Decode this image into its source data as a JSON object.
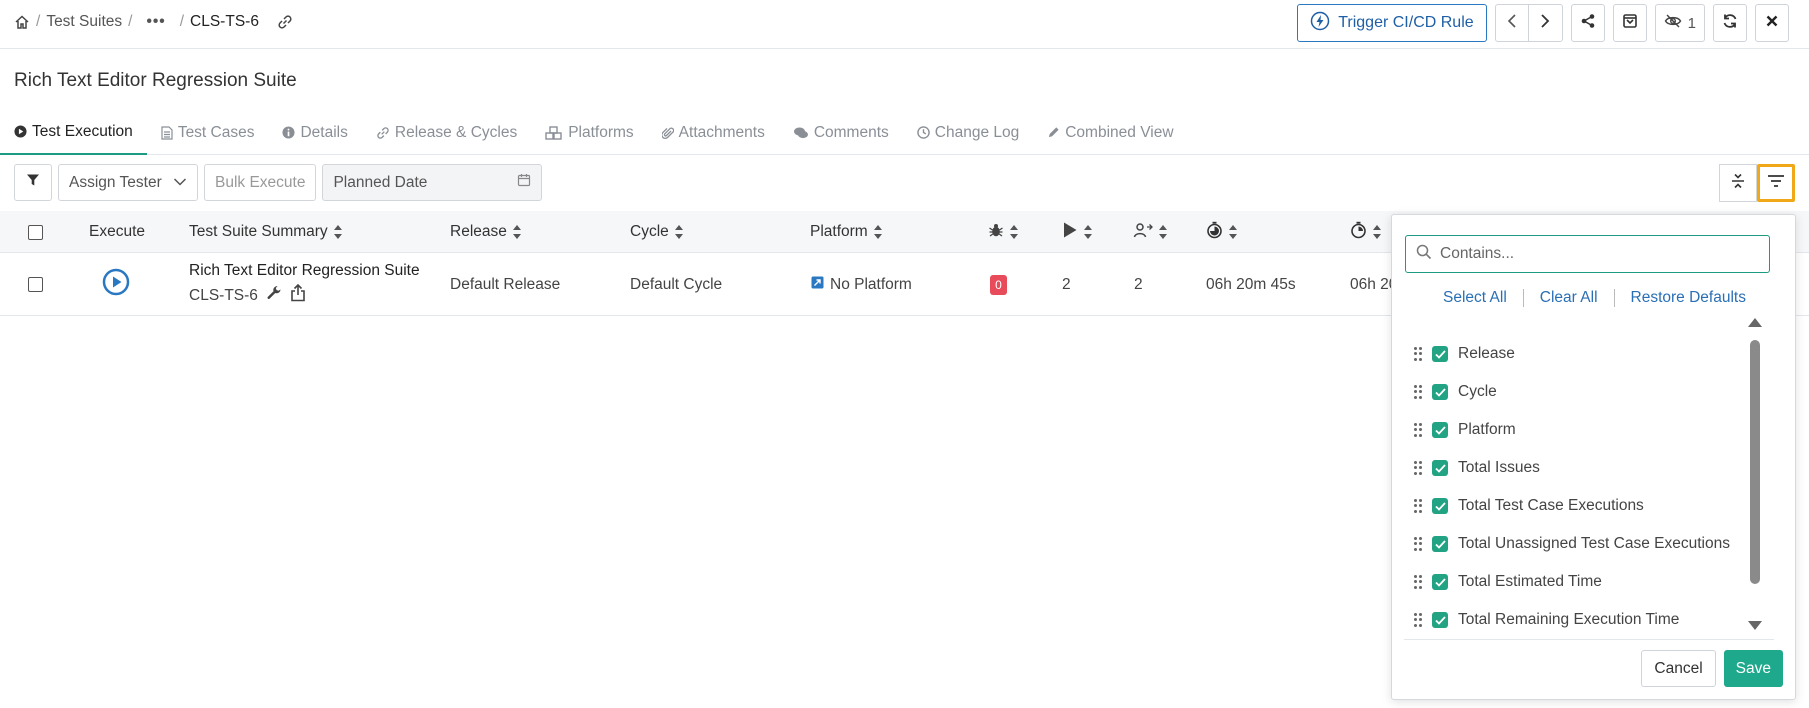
{
  "breadcrumb": {
    "items": [
      "Test Suites",
      "CLS-TS-6"
    ],
    "separator": "/"
  },
  "header": {
    "trigger_label": "Trigger CI/CD Rule",
    "watchers_count": "1"
  },
  "page_title": "Rich Text Editor Regression Suite",
  "tabs": [
    {
      "label": "Test Execution",
      "icon": "play-circle-icon"
    },
    {
      "label": "Test Cases",
      "icon": "file-icon"
    },
    {
      "label": "Details",
      "icon": "info-icon"
    },
    {
      "label": "Release & Cycles",
      "icon": "link-icon"
    },
    {
      "label": "Platforms",
      "icon": "cubes-icon"
    },
    {
      "label": "Attachments",
      "icon": "paperclip-icon"
    },
    {
      "label": "Comments",
      "icon": "comments-icon"
    },
    {
      "label": "Change Log",
      "icon": "clock-icon"
    },
    {
      "label": "Combined View",
      "icon": "pencil-icon"
    }
  ],
  "toolbar": {
    "assign_tester": "Assign Tester",
    "bulk_execute": "Bulk Execute",
    "planned_date_placeholder": "Planned Date"
  },
  "table": {
    "headers": {
      "execute": "Execute",
      "summary": "Test Suite Summary",
      "release": "Release",
      "cycle": "Cycle",
      "platform": "Platform"
    },
    "rows": [
      {
        "summary": "Rich Text Editor Regression Suite",
        "key": "CLS-TS-6",
        "release": "Default Release",
        "cycle": "Default Cycle",
        "platform": "No Platform",
        "issues": "0",
        "executions": "2",
        "unassigned": "2",
        "estimated_time": "06h 20m 45s",
        "remaining_time": "06h 20"
      }
    ]
  },
  "column_chooser": {
    "search_placeholder": "Contains...",
    "select_all": "Select All",
    "clear_all": "Clear All",
    "restore_defaults": "Restore Defaults",
    "columns": [
      {
        "label": "Release",
        "checked": true
      },
      {
        "label": "Cycle",
        "checked": true
      },
      {
        "label": "Platform",
        "checked": true
      },
      {
        "label": "Total Issues",
        "checked": true
      },
      {
        "label": "Total Test Case Executions",
        "checked": true
      },
      {
        "label": "Total Unassigned Test Case Executions",
        "checked": true
      },
      {
        "label": "Total Estimated Time",
        "checked": true
      },
      {
        "label": "Total Remaining Execution Time",
        "checked": true
      }
    ],
    "cancel_label": "Cancel",
    "save_label": "Save"
  },
  "colors": {
    "accent_green": "#1fa98c",
    "link_blue": "#2a6fb5",
    "highlight_orange": "#f0a818",
    "issue_red": "#e84b5a"
  }
}
